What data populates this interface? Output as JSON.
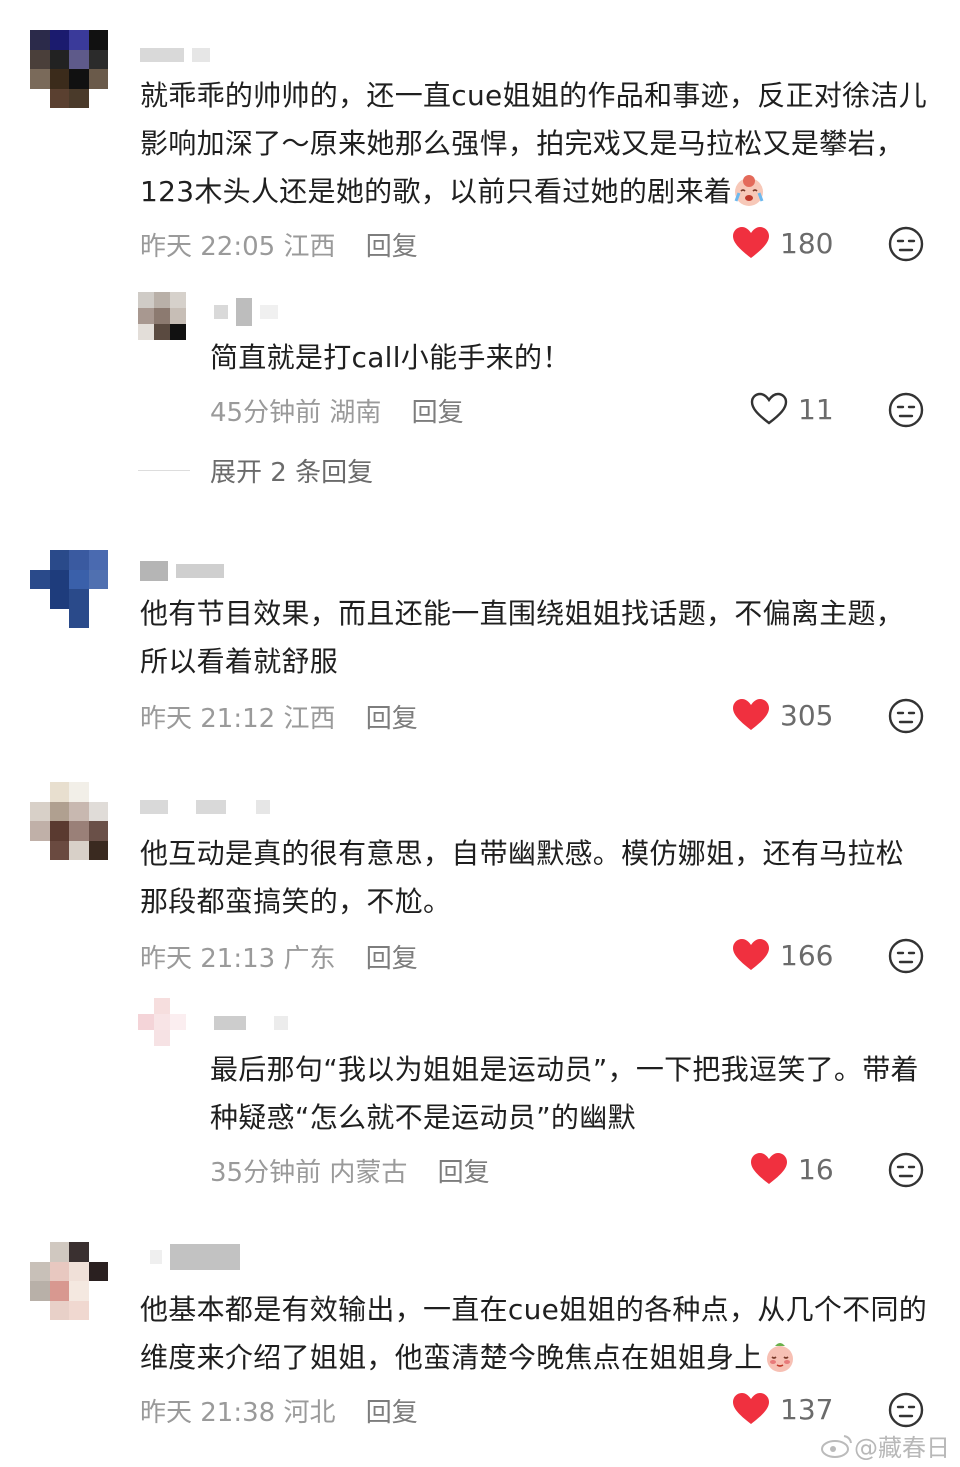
{
  "colors": {
    "like_active": "#f0303f",
    "meta": "#9a9a9a",
    "text": "#1f1f1f"
  },
  "comments": [
    {
      "text": "就乖乖的帅帅的，还一直cue姐姐的作品和事迹，反正对徐洁儿影响加深了～原来她那么强悍，拍完戏又是马拉松又是攀岩，123木头人还是她的歌，以前只看过她的剧来着",
      "emoji": "crying-face-icon",
      "time": "昨天 22:05",
      "location": "江西",
      "reply_label": "回复",
      "likes": "180",
      "liked": true,
      "replies": [
        {
          "text": "简直就是打call小能手来的！",
          "time": "45分钟前",
          "location": "湖南",
          "reply_label": "回复",
          "likes": "11",
          "liked": false
        }
      ],
      "expand_label": "展开 2 条回复"
    },
    {
      "text": "他有节目效果，而且还能一直围绕姐姐找话题，不偏离主题，所以看着就舒服",
      "time": "昨天 21:12",
      "location": "江西",
      "reply_label": "回复",
      "likes": "305",
      "liked": true
    },
    {
      "text": "他互动是真的很有意思，自带幽默感。模仿娜姐，还有马拉松那段都蛮搞笑的，不尬。",
      "time": "昨天 21:13",
      "location": "广东",
      "reply_label": "回复",
      "likes": "166",
      "liked": true,
      "replies": [
        {
          "text": "最后那句“我以为姐姐是运动员”，一下把我逗笑了。带着种疑惑“怎么就不是运动员”的幽默",
          "time": "35分钟前",
          "location": "内蒙古",
          "reply_label": "回复",
          "likes": "16",
          "liked": true
        }
      ]
    },
    {
      "text": "他基本都是有效输出，一直在cue姐姐的各种点，从几个不同的维度来介绍了姐姐，他蛮清楚今晚焦点在姐姐身上",
      "emoji": "shy-face-icon",
      "time": "昨天 21:38",
      "location": "河北",
      "reply_label": "回复",
      "likes": "137",
      "liked": true
    }
  ],
  "watermark": "@藏春日"
}
